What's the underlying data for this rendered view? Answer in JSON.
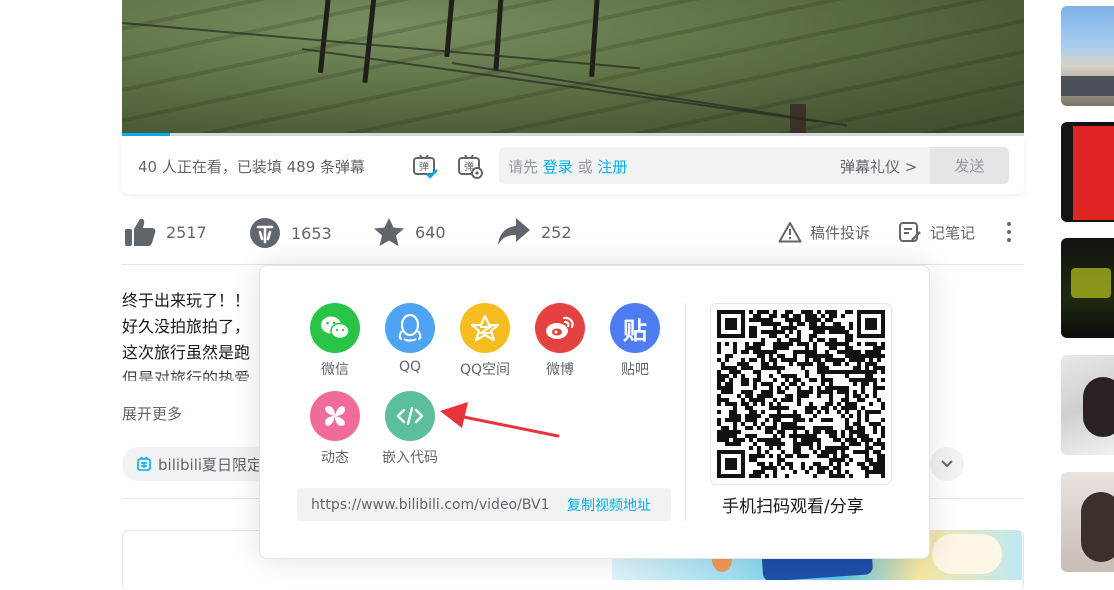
{
  "player": {
    "viewer_text": "40 人正在看，已装填 489 条弹幕",
    "input_prefix": "请先",
    "login_link": "登录",
    "or_text": "或",
    "register_link": "注册",
    "etiquette": "弹幕礼仪 >",
    "send": "发送"
  },
  "toolbar": {
    "like_count": "2517",
    "coin_count": "1653",
    "favorite_count": "640",
    "share_count": "252",
    "report_label": "稿件投诉",
    "notes_label": "记笔记"
  },
  "description": {
    "lines": [
      "终于出来玩了！！",
      "好久没拍旅拍了，",
      "这次旅行虽然是跑",
      "但是对旅行的热爱"
    ],
    "expand": "展开更多"
  },
  "tags": {
    "first": "bilibili夏日限定"
  },
  "share_popup": {
    "items": [
      {
        "label": "微信",
        "icon": "wechat-icon",
        "color": "#28c445"
      },
      {
        "label": "QQ",
        "icon": "qq-icon",
        "color": "#4fa3f3"
      },
      {
        "label": "QQ空间",
        "icon": "qzone-icon",
        "color": "#f6bd1f"
      },
      {
        "label": "微博",
        "icon": "weibo-icon",
        "color": "#e64141"
      },
      {
        "label": "贴吧",
        "icon": "tieba-icon",
        "color": "#4e7cf1"
      },
      {
        "label": "动态",
        "icon": "dynamic-icon",
        "color": "#f16b9a"
      },
      {
        "label": "嵌入代码",
        "icon": "embed-code-icon",
        "color": "#5bbf9a"
      }
    ],
    "tieba_glyph": "贴",
    "url": "https://www.bilibili.com/video/BV1",
    "copy_link": "复制视频地址",
    "qr_caption": "手机扫码观看/分享"
  },
  "colors": {
    "accent": "#00aeec",
    "arrow": "#e8333b"
  }
}
